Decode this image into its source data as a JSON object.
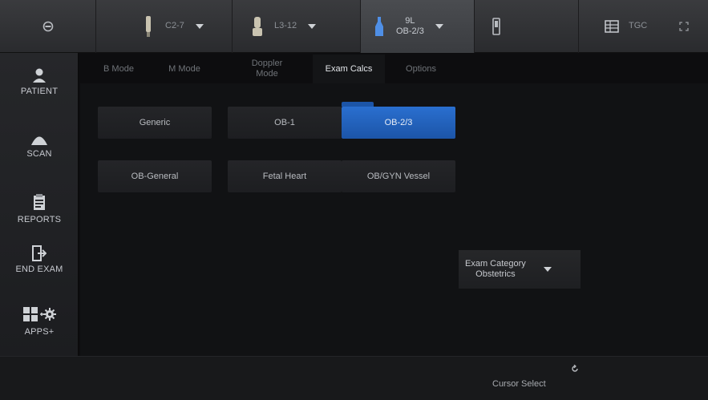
{
  "topbar": {
    "probes": [
      {
        "label": "C2-7",
        "active": false
      },
      {
        "label": "L3-12",
        "active": false
      },
      {
        "label_line1": "9L",
        "label_line2": "OB-2/3",
        "active": true
      }
    ],
    "tgc_label": "TGC"
  },
  "sidebar": {
    "items": [
      {
        "label": "PATIENT",
        "icon": "patient-icon"
      },
      {
        "label": "SCAN",
        "icon": "scan-icon"
      },
      {
        "label": "REPORTS",
        "icon": "reports-icon"
      },
      {
        "label": "END EXAM",
        "icon": "end-exam-icon"
      },
      {
        "label": "APPS+",
        "icon": "apps-icon"
      }
    ]
  },
  "tabs": [
    {
      "label": "B Mode",
      "active": false
    },
    {
      "label": "M Mode",
      "active": false
    },
    {
      "label_line1": "Doppler",
      "label_line2": "Mode",
      "active": false
    },
    {
      "label": "Exam Calcs",
      "active": true
    },
    {
      "label": "Options",
      "active": false
    }
  ],
  "calc_buttons": [
    {
      "label": "Generic",
      "selected": false
    },
    {
      "label": "OB-1",
      "selected": false
    },
    {
      "label": "OB-2/3",
      "selected": true
    },
    {
      "label": "OB-General",
      "selected": false
    },
    {
      "label": "Fetal Heart",
      "selected": false
    },
    {
      "label": "OB/GYN Vessel",
      "selected": false
    }
  ],
  "exam_category": {
    "label": "Exam Category",
    "value": "Obstetrics"
  },
  "bottom": {
    "cursor_select": "Cursor Select"
  },
  "colors": {
    "accent": "#1f5fbf",
    "background": "#0d0d0f"
  }
}
